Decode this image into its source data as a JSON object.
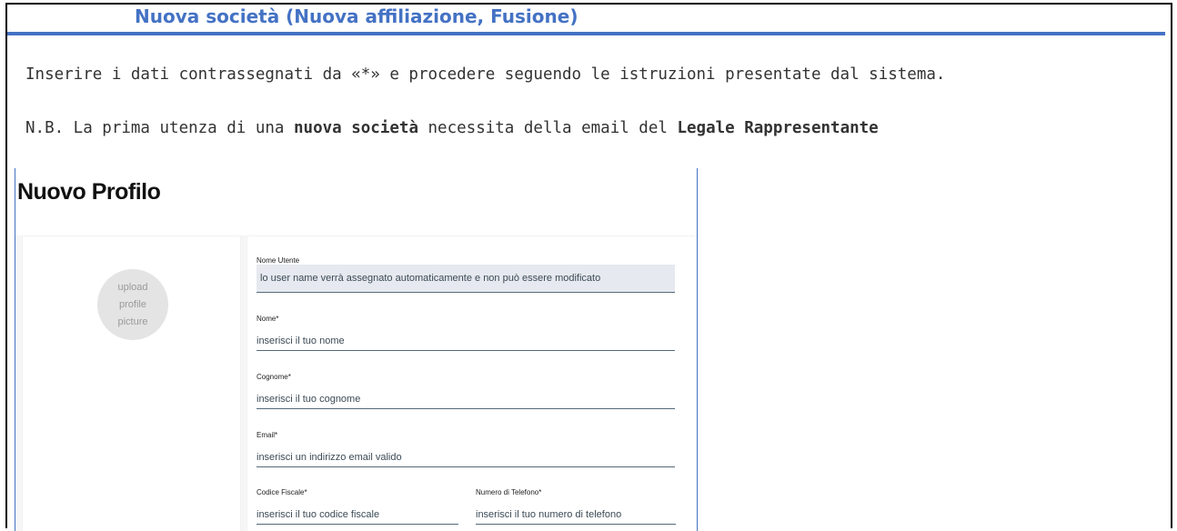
{
  "section": {
    "title": "Nuova società (Nuova affiliazione, Fusione)"
  },
  "instructions": {
    "line1": "Inserire i dati contrassegnati da «*» e procedere seguendo le istruzioni presentate dal sistema.",
    "line2_prefix": "N.B. La prima utenza di una ",
    "line2_bold1": "nuova società",
    "line2_middle": " necessita della email del ",
    "line2_bold2": "Legale Rappresentante"
  },
  "profile_form": {
    "title": "Nuovo Profilo",
    "avatar_text": "upload profile picture",
    "fields": {
      "username": {
        "label": "Nome Utente",
        "value": "lo user name verrà assegnato automaticamente e non può essere modificato"
      },
      "nome": {
        "label": "Nome*",
        "placeholder": "inserisci il tuo nome"
      },
      "cognome": {
        "label": "Cognome*",
        "placeholder": "inserisci il tuo cognome"
      },
      "email": {
        "label": "Email*",
        "placeholder": "inserisci un indirizzo email valido"
      },
      "codice_fiscale": {
        "label": "Codice Fiscale*",
        "placeholder": "inserisci il tuo codice fiscale"
      },
      "telefono": {
        "label": "Numero di Telefono*",
        "placeholder": "inserisci il tuo numero di telefono"
      }
    }
  },
  "colors": {
    "accent": "#4472c4",
    "field_underline": "#566977",
    "readonly_bg": "#e6e9ef"
  }
}
